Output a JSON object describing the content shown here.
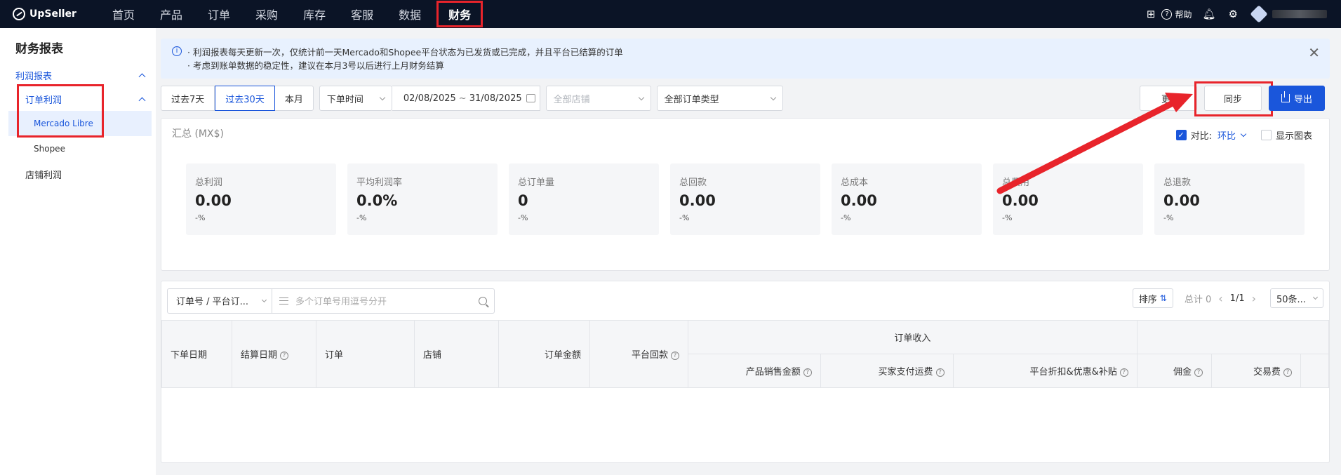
{
  "topbar": {
    "brand": "UpSeller",
    "nav": [
      "首页",
      "产品",
      "订单",
      "采购",
      "库存",
      "客服",
      "数据",
      "财务"
    ],
    "active_nav": "财务",
    "help": "帮助"
  },
  "sidebar": {
    "title": "财务报表",
    "group": "利润报表",
    "sub": "订单利润",
    "leaf_selected": "Mercado Libre",
    "leaf_other": "Shopee",
    "store_profit": "店铺利润"
  },
  "notice": {
    "line1": "· 利润报表每天更新一次，仅统计前一天Mercado和Shopee平台状态为已发货或已完成，并且平台已结算的订单",
    "line2": "· 考虑到账单数据的稳定性，建议在本月3号以后进行上月财务结算"
  },
  "filters": {
    "ranges": [
      "过去7天",
      "过去30天",
      "本月"
    ],
    "active_range": "过去30天",
    "time_type": "下单时间",
    "date_start": "02/08/2025",
    "date_sep": "~",
    "date_end": "31/08/2025",
    "store_placeholder": "全部店铺",
    "order_type": "全部订单类型",
    "more": "更多",
    "sync": "同步",
    "export": "导出"
  },
  "summary": {
    "title": "汇总 (MX$)",
    "compare_label": "对比:",
    "compare_value": "环比",
    "show_chart": "显示图表",
    "cards": [
      {
        "label": "总利润",
        "value": "0.00",
        "pct": "-%"
      },
      {
        "label": "平均利润率",
        "value": "0.0%",
        "pct": "-%"
      },
      {
        "label": "总订单量",
        "value": "0",
        "pct": "-%"
      },
      {
        "label": "总回款",
        "value": "0.00",
        "pct": "-%"
      },
      {
        "label": "总成本",
        "value": "0.00",
        "pct": "-%"
      },
      {
        "label": "总费用",
        "value": "0.00",
        "pct": "-%"
      },
      {
        "label": "总退款",
        "value": "0.00",
        "pct": "-%"
      }
    ]
  },
  "table": {
    "search_type": "订单号 / 平台订...",
    "search_placeholder": "多个订单号用逗号分开",
    "sort": "排序",
    "total": "总计 0",
    "page": "1/1",
    "page_size": "50条...",
    "headers": {
      "order_date": "下单日期",
      "settle_date": "结算日期",
      "order": "订单",
      "store": "店铺",
      "order_amount": "订单金额",
      "platform_payback": "平台回款",
      "income_group": "订单收入",
      "product_sales": "产品销售金额",
      "buyer_shipping": "买家支付运费",
      "platform_discount": "平台折扣&优惠&补贴",
      "commission": "佣金",
      "transaction_fee": "交易费"
    }
  }
}
